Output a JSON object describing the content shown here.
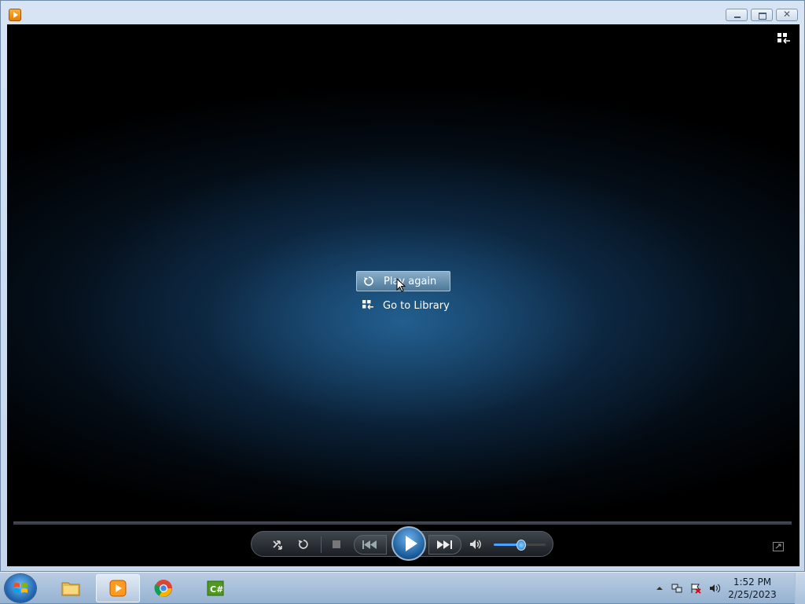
{
  "window": {
    "title": "",
    "caption_buttons": [
      "minimize",
      "maximize",
      "close"
    ]
  },
  "overlay_menu": {
    "items": [
      {
        "label": "Play again",
        "icon": "replay-icon",
        "selected": true
      },
      {
        "label": "Go to Library",
        "icon": "switch-to-library-icon",
        "selected": false
      }
    ]
  },
  "controls": {
    "buttons": [
      "shuffle",
      "repeat",
      "stop",
      "previous",
      "play",
      "next",
      "mute"
    ],
    "volume_level": 0.5
  },
  "taskbar": {
    "apps": [
      "windows-explorer",
      "windows-media-player",
      "google-chrome",
      "csharp-editor"
    ],
    "active_app": "windows-media-player",
    "clock_time": "1:52 PM",
    "clock_date": "2/25/2023"
  },
  "colors": {
    "accent": "#1e5f9e",
    "stage_glow": "#286ea5",
    "taskbar": "#96b2d1"
  }
}
